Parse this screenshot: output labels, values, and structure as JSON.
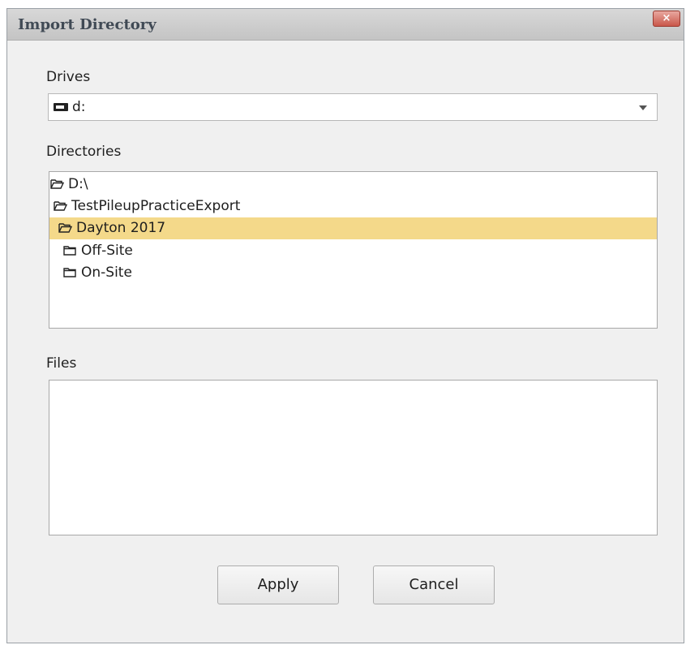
{
  "window": {
    "title": "Import Directory",
    "close_label": "×"
  },
  "drives": {
    "label": "Drives",
    "selected": "d:"
  },
  "directories": {
    "label": "Directories",
    "items": [
      {
        "label": "D:\\",
        "state": "open"
      },
      {
        "label": "TestPileupPracticeExport",
        "state": "open"
      },
      {
        "label": "Dayton 2017",
        "state": "open-selected"
      },
      {
        "label": "Off-Site",
        "state": "closed"
      },
      {
        "label": "On-Site",
        "state": "closed"
      }
    ]
  },
  "files": {
    "label": "Files",
    "items": []
  },
  "buttons": {
    "apply": "Apply",
    "cancel": "Cancel"
  },
  "colors": {
    "selection": "#f4d98a",
    "close_button": "#c9574a"
  },
  "icons": {
    "drive": "drive-icon",
    "open_folder": "folder-open-icon",
    "closed_folder": "folder-icon"
  }
}
